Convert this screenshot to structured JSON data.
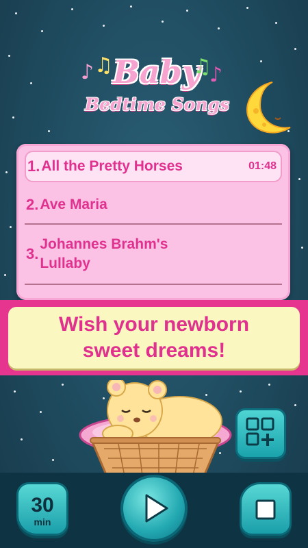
{
  "app": {
    "logo_title": "Baby",
    "logo_subtitle": "Bedtime Songs"
  },
  "playlist": {
    "tracks": [
      {
        "number": "1.",
        "title": "All the Pretty Horses",
        "duration": "01:48",
        "active": true
      },
      {
        "number": "2.",
        "title": "Ave Maria"
      },
      {
        "number": "3.",
        "title": "Johannes Brahm's Lullaby"
      }
    ]
  },
  "banner": {
    "text": "Wish your newborn sweet dreams!"
  },
  "controls": {
    "timer_value": "30",
    "timer_unit": "min",
    "play_icon": "play-icon",
    "stop_icon": "stop-icon",
    "add_icon": "add-to-playlist-icon"
  },
  "colors": {
    "accent_pink": "#e0318f",
    "card_pink": "#fbc2e5",
    "teal": "#22a8b1",
    "banner_yellow": "#fbf7c0"
  }
}
